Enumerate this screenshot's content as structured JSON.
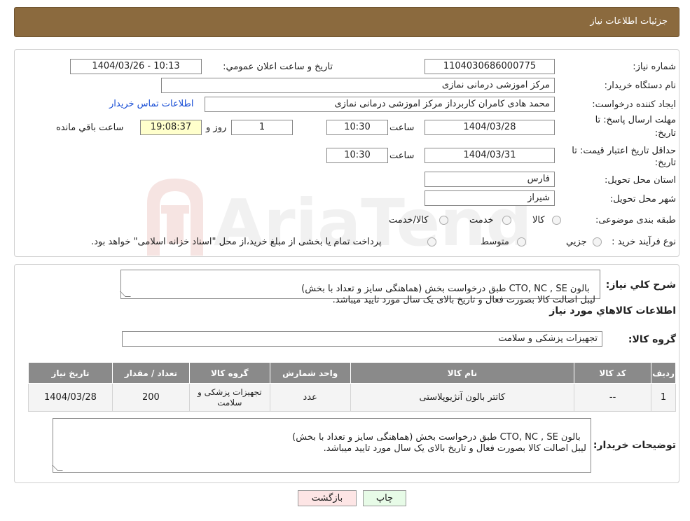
{
  "header": {
    "title": "جزئیات اطلاعات نیاز"
  },
  "watermark": {
    "text": "AriaTender.neT"
  },
  "form": {
    "need_number_label": "شماره نیاز:",
    "need_number": "1104030686000775",
    "announce_label": "تاریخ و ساعت اعلان عمومي:",
    "announce_value": "1404/03/26 - 10:13",
    "buyer_org_label": "نام دستگاه خريدار:",
    "buyer_org": "مرکز اموزشی درمانی نمازی",
    "creator_label": "ايجاد کننده درخواست:",
    "creator": "محمد هادی کامران کاربرداز مرکز اموزشی درمانی نمازی",
    "contact_link": "اطلاعات تماس خريدار",
    "deadline_label_1": "مهلت ارسال پاسخ: تا",
    "deadline_label_2": "تاريخ:",
    "deadline_date": "1404/03/28",
    "time_label": "ساعت",
    "deadline_time": "10:30",
    "days_value": "1",
    "days_label": "روز و",
    "remaining_time": "19:08:37",
    "remaining_label": "ساعت باقي مانده",
    "validity_label_1": "حداقل تاريخ اعتبار قيمت: تا",
    "validity_label_2": "تاريخ:",
    "validity_date": "1404/03/31",
    "validity_time": "10:30",
    "province_label": "استان محل تحويل:",
    "province": "فارس",
    "city_label": "شهر محل تحويل:",
    "city": "شیراز",
    "category_label": "طبقه بندی موضوعی:",
    "category_options": [
      "کالا",
      "خدمت",
      "کالا/خدمت"
    ],
    "purchase_label": "نوع فرآيند خريد :",
    "purchase_options": [
      "جزيي",
      "متوسط"
    ],
    "purchase_note": "پرداخت تمام يا بخشی از مبلغ خريد،از محل \"اسناد خزانه اسلامی\" خواهد بود."
  },
  "summary": {
    "label": "شرح کلي نياز:",
    "text": "بالون CTO, NC , SE طبق درخواست بخش (هماهنگی سایز و تعداد با بخش)\nلیبل اصالت کالا بصورت فعال و تاریخ بالای یک سال مورد تایید میباشد."
  },
  "goods": {
    "section_title": "اطلاعات کالاهاي مورد نياز",
    "group_label": "گروه کالا:",
    "group_value": "تجهیزات پزشکی و سلامت",
    "columns": [
      "رديف",
      "کد کالا",
      "نام کالا",
      "واحد شمارش",
      "گروه کالا",
      "تعداد / مقدار",
      "تاريخ نياز"
    ],
    "rows": [
      [
        "1",
        "--",
        "کاتتر بالون آنژیوپلاستی",
        "عدد",
        "تجهیزات پزشکی و سلامت",
        "200",
        "1404/03/28"
      ]
    ]
  },
  "buyer_notes": {
    "label": "توضيحات خريدار:",
    "text": "بالون CTO, NC , SE طبق درخواست بخش (هماهنگی سایز و تعداد با بخش)\nلیبل اصالت کالا بصورت فعال و تاریخ بالای یک سال مورد تایید میباشد."
  },
  "buttons": {
    "print": "چاپ",
    "back": "بازگشت"
  },
  "colors": {
    "header": "#8b6a3e",
    "table_header": "#8a8a8a",
    "remaining_bg": "#ffffcc",
    "back_bg": "#fde5e5",
    "print_bg": "#e7fbe7"
  }
}
